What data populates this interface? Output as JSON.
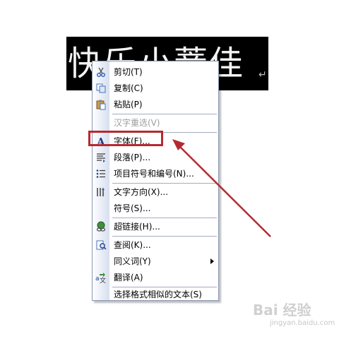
{
  "document": {
    "text": "快乐小薏佳",
    "paragraph_mark": "↵"
  },
  "context_menu": {
    "items": [
      {
        "label": "剪切(T)",
        "icon": "scissors-icon",
        "disabled": false
      },
      {
        "label": "复制(C)",
        "icon": "copy-icon",
        "disabled": false
      },
      {
        "label": "粘贴(P)",
        "icon": "paste-icon",
        "disabled": false
      },
      {
        "label": "汉字重选(V)",
        "icon": "",
        "disabled": true
      },
      {
        "label": "字体(F)...",
        "icon": "font-a-icon",
        "disabled": false
      },
      {
        "label": "段落(P)...",
        "icon": "paragraph-icon",
        "disabled": false
      },
      {
        "label": "项目符号和编号(N)...",
        "icon": "bullets-icon",
        "disabled": false
      },
      {
        "label": "文字方向(X)...",
        "icon": "text-direction-icon",
        "disabled": false
      },
      {
        "label": "符号(S)...",
        "icon": "",
        "disabled": false
      },
      {
        "label": "超链接(H)...",
        "icon": "hyperlink-icon",
        "disabled": false
      },
      {
        "label": "查阅(K)...",
        "icon": "research-icon",
        "disabled": false
      },
      {
        "label": "同义词(Y)",
        "icon": "",
        "disabled": false,
        "submenu": true
      },
      {
        "label": "翻译(A)",
        "icon": "translate-icon",
        "disabled": false
      },
      {
        "label": "选择格式相似的文本(S)",
        "icon": "",
        "disabled": false
      }
    ]
  },
  "annotation": {
    "highlight_color": "#b52a30",
    "highlighted_item": "字体(F)..."
  },
  "watermark": {
    "text": "Bai 经验",
    "subtext": "jingyan.baidu.com"
  }
}
